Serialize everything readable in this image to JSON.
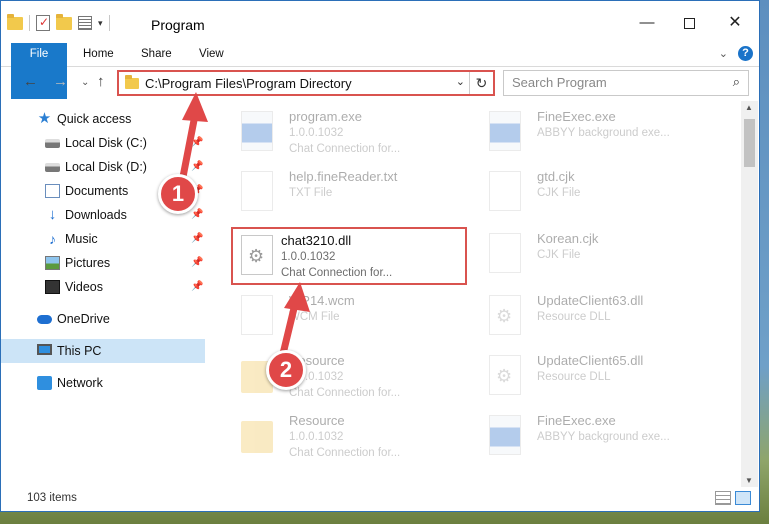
{
  "window": {
    "title": "Program",
    "qat_icons": [
      "folder-icon",
      "properties-check-icon",
      "new-folder-icon",
      "properties-list-icon"
    ]
  },
  "ribbon": {
    "tabs": [
      {
        "label": "File",
        "active": true
      },
      {
        "label": "Home"
      },
      {
        "label": "Share"
      },
      {
        "label": "View"
      }
    ]
  },
  "navbar": {
    "address": "C:\\Program Files\\Program Directory",
    "search_placeholder": "Search Program"
  },
  "sidebar": {
    "items": [
      {
        "label": "Quick access",
        "icon": "star-icon",
        "pinned": false
      },
      {
        "label": "Local Disk (C:)",
        "icon": "drive-icon",
        "pinned": true
      },
      {
        "label": "Local Disk (D:)",
        "icon": "drive-icon",
        "pinned": true
      },
      {
        "label": "Documents",
        "icon": "documents-icon",
        "pinned": true
      },
      {
        "label": "Downloads",
        "icon": "downloads-icon",
        "pinned": true
      },
      {
        "label": "Music",
        "icon": "music-icon",
        "pinned": true
      },
      {
        "label": "Pictures",
        "icon": "pictures-icon",
        "pinned": true
      },
      {
        "label": "Videos",
        "icon": "videos-icon",
        "pinned": true
      },
      {
        "label": "OneDrive",
        "icon": "onedrive-icon",
        "pinned": false
      },
      {
        "label": "This PC",
        "icon": "this-pc-icon",
        "pinned": false,
        "selected": true
      },
      {
        "label": "Network",
        "icon": "network-icon",
        "pinned": false
      }
    ]
  },
  "files": {
    "left": [
      {
        "name": "program.exe",
        "line2": "1.0.0.1032",
        "line3": "Chat Connection for...",
        "type": "exe"
      },
      {
        "name": "help.fineReader.txt",
        "line2": "TXT File",
        "line3": "",
        "type": "txt"
      },
      {
        "name": "chat3210.dll",
        "line2": "1.0.0.1032",
        "line3": "Chat Connection for...",
        "type": "dll"
      },
      {
        "name": "WP14.wcm",
        "line2": "WCM File",
        "line3": "",
        "type": "txt"
      },
      {
        "name": "Resource",
        "line2": "1.0.0.1032",
        "line3": "Chat Connection for...",
        "type": "folder"
      },
      {
        "name": "Resource",
        "line2": "1.0.0.1032",
        "line3": "Chat Connection for...",
        "type": "folder"
      }
    ],
    "right": [
      {
        "name": "FineExec.exe",
        "line2": "ABBYY background exe...",
        "line3": "",
        "type": "exe"
      },
      {
        "name": "gtd.cjk",
        "line2": "CJK File",
        "line3": "",
        "type": "txt"
      },
      {
        "name": "Korean.cjk",
        "line2": "CJK File",
        "line3": "",
        "type": "txt"
      },
      {
        "name": "UpdateClient63.dll",
        "line2": "Resource DLL",
        "line3": "",
        "type": "dll"
      },
      {
        "name": "UpdateClient65.dll",
        "line2": "Resource DLL",
        "line3": "",
        "type": "dll"
      },
      {
        "name": "FineExec.exe",
        "line2": "ABBYY background exe...",
        "line3": "",
        "type": "exe"
      }
    ]
  },
  "status": {
    "item_count": "103 items"
  },
  "annotations": {
    "step1": "1",
    "step2": "2",
    "color": "#e04848"
  }
}
